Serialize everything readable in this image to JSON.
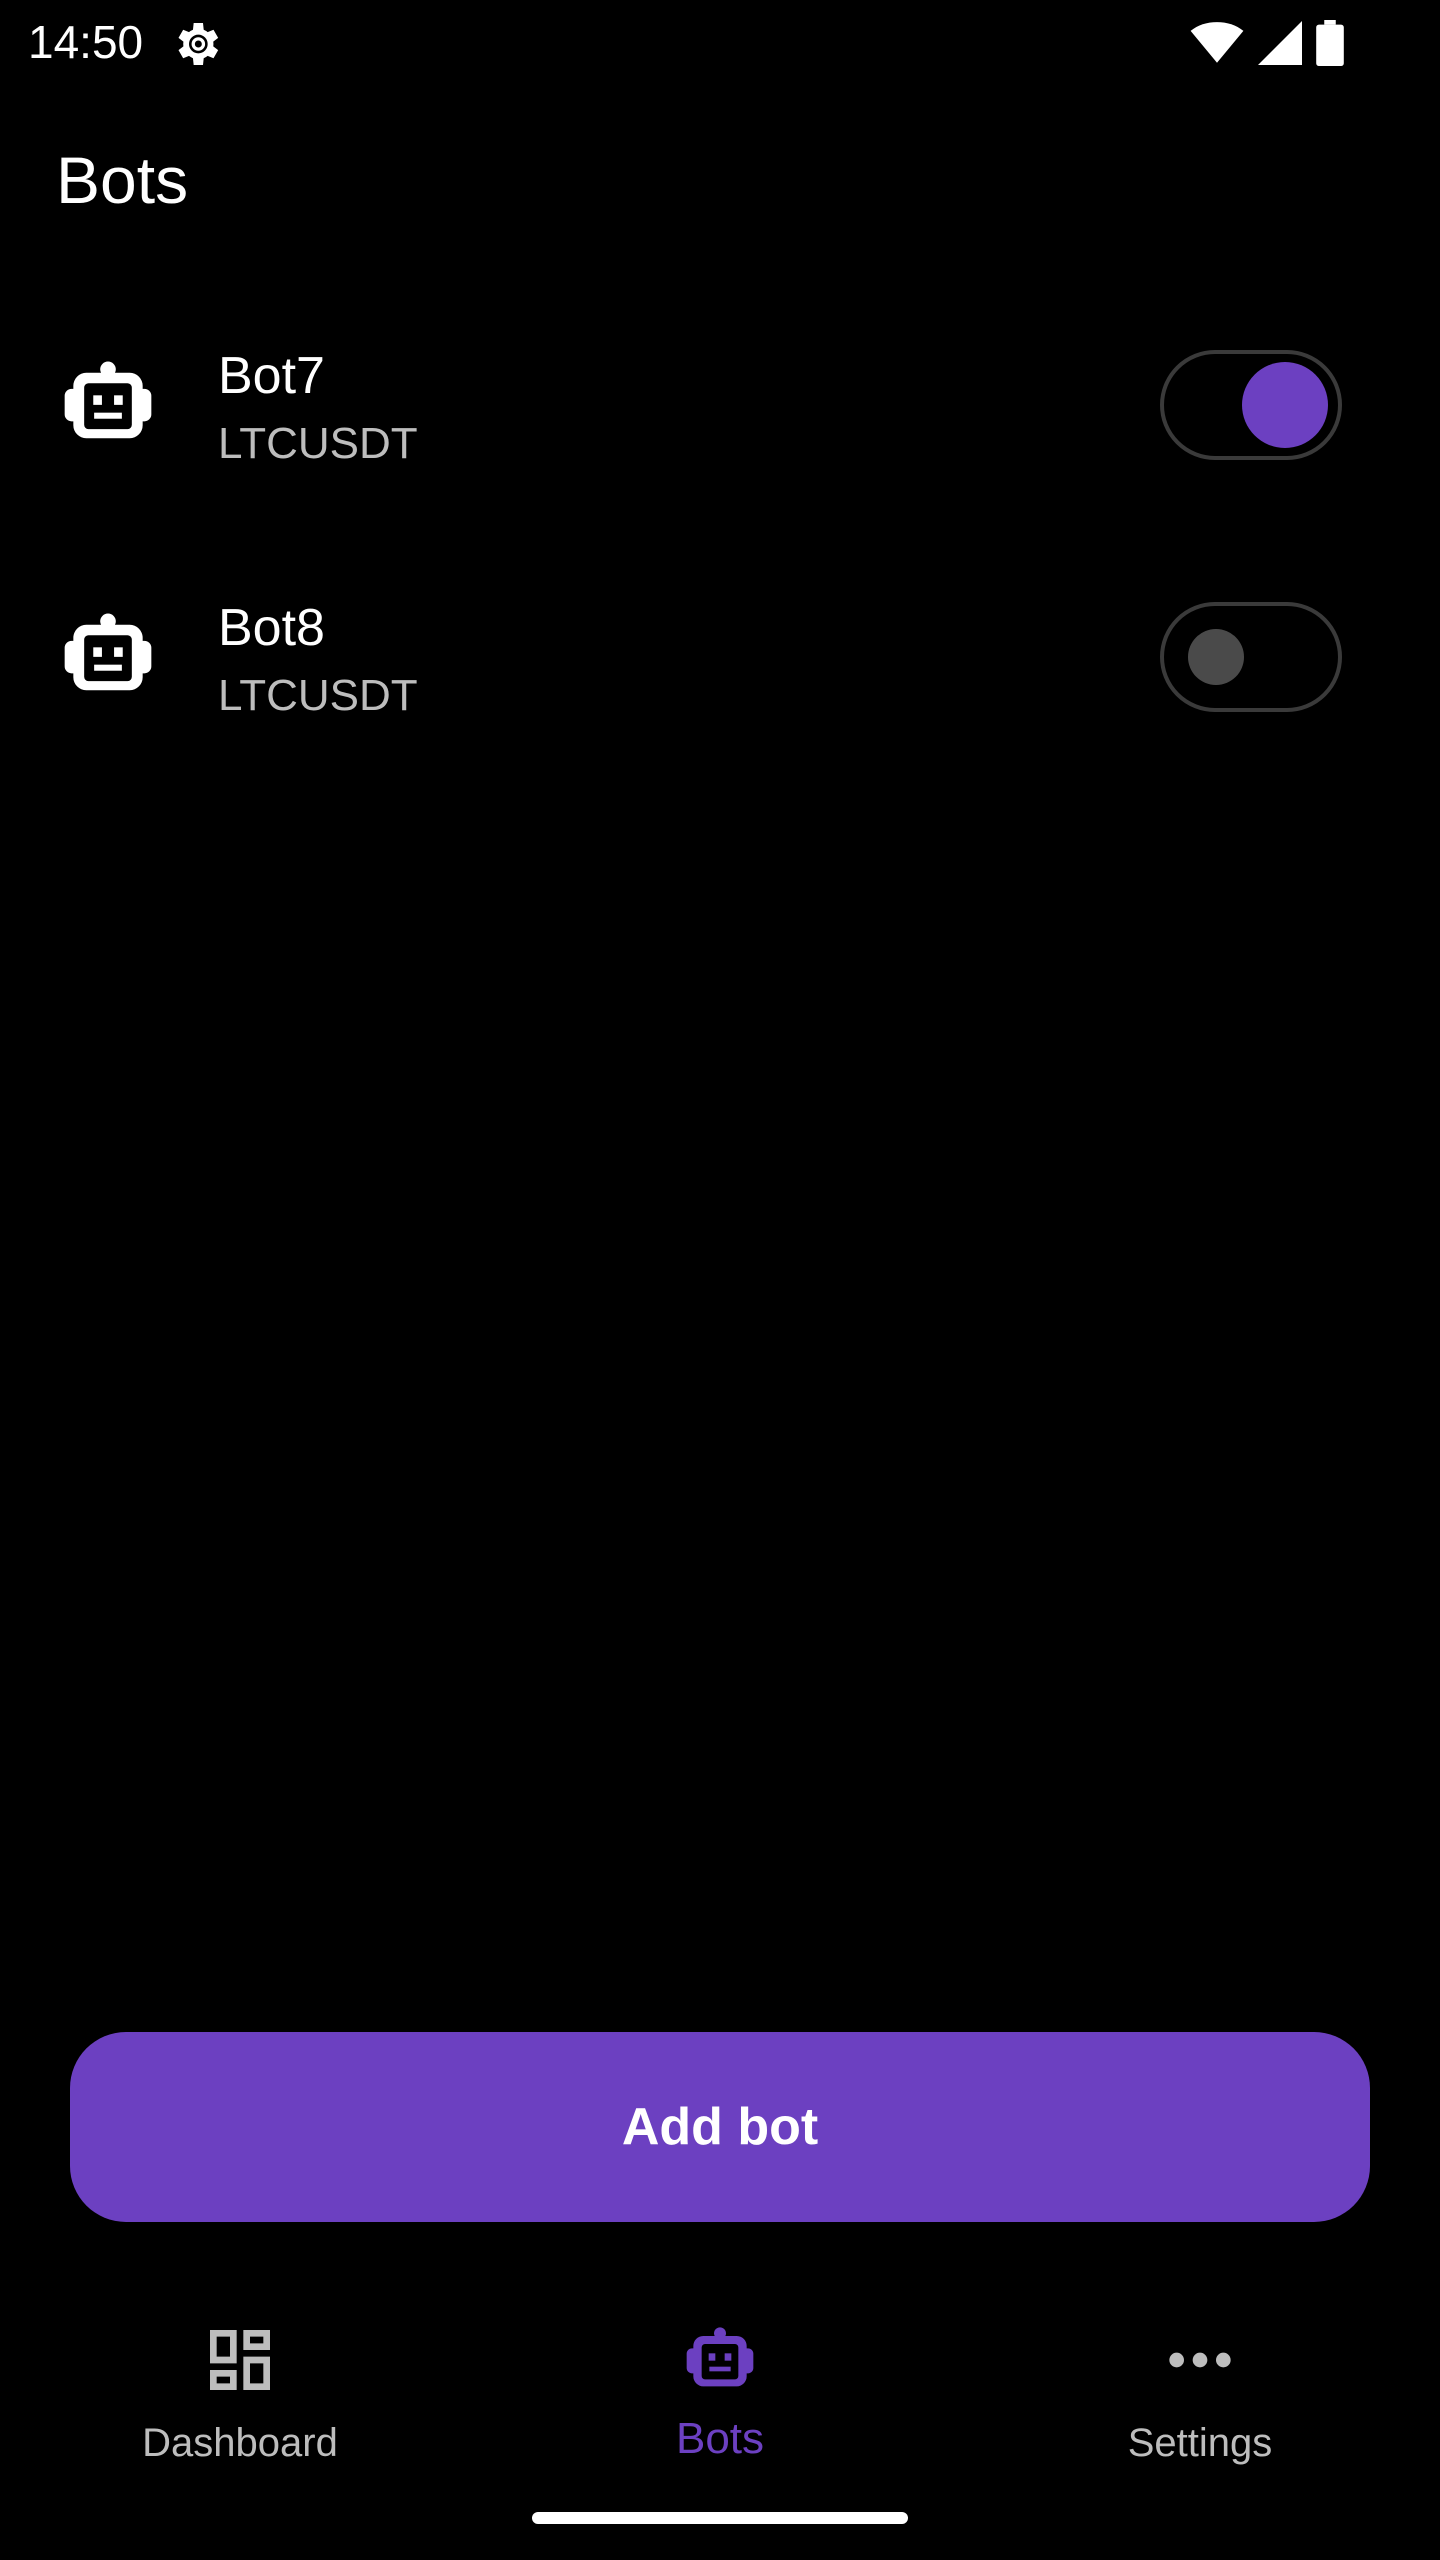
{
  "status_bar": {
    "time": "14:50",
    "icons": [
      "settings-gear-icon",
      "wifi-icon",
      "signal-icon",
      "battery-icon"
    ]
  },
  "header": {
    "title": "Bots"
  },
  "bots": [
    {
      "name": "Bot7",
      "symbol": "LTCUSDT",
      "enabled": true,
      "icon": "robot-icon"
    },
    {
      "name": "Bot8",
      "symbol": "LTCUSDT",
      "enabled": false,
      "icon": "robot-icon"
    }
  ],
  "add_button": {
    "label": "Add bot"
  },
  "bottom_nav": {
    "items": [
      {
        "label": "Dashboard",
        "icon": "dashboard-icon",
        "active": false
      },
      {
        "label": "Bots",
        "icon": "robot-icon",
        "active": true
      },
      {
        "label": "Settings",
        "icon": "more-horizontal-icon",
        "active": false
      }
    ]
  },
  "colors": {
    "accent": "#6c40c1",
    "background": "#000000",
    "secondary_text": "#bdbdbd",
    "toggle_off_knob": "#4a4a4a"
  }
}
